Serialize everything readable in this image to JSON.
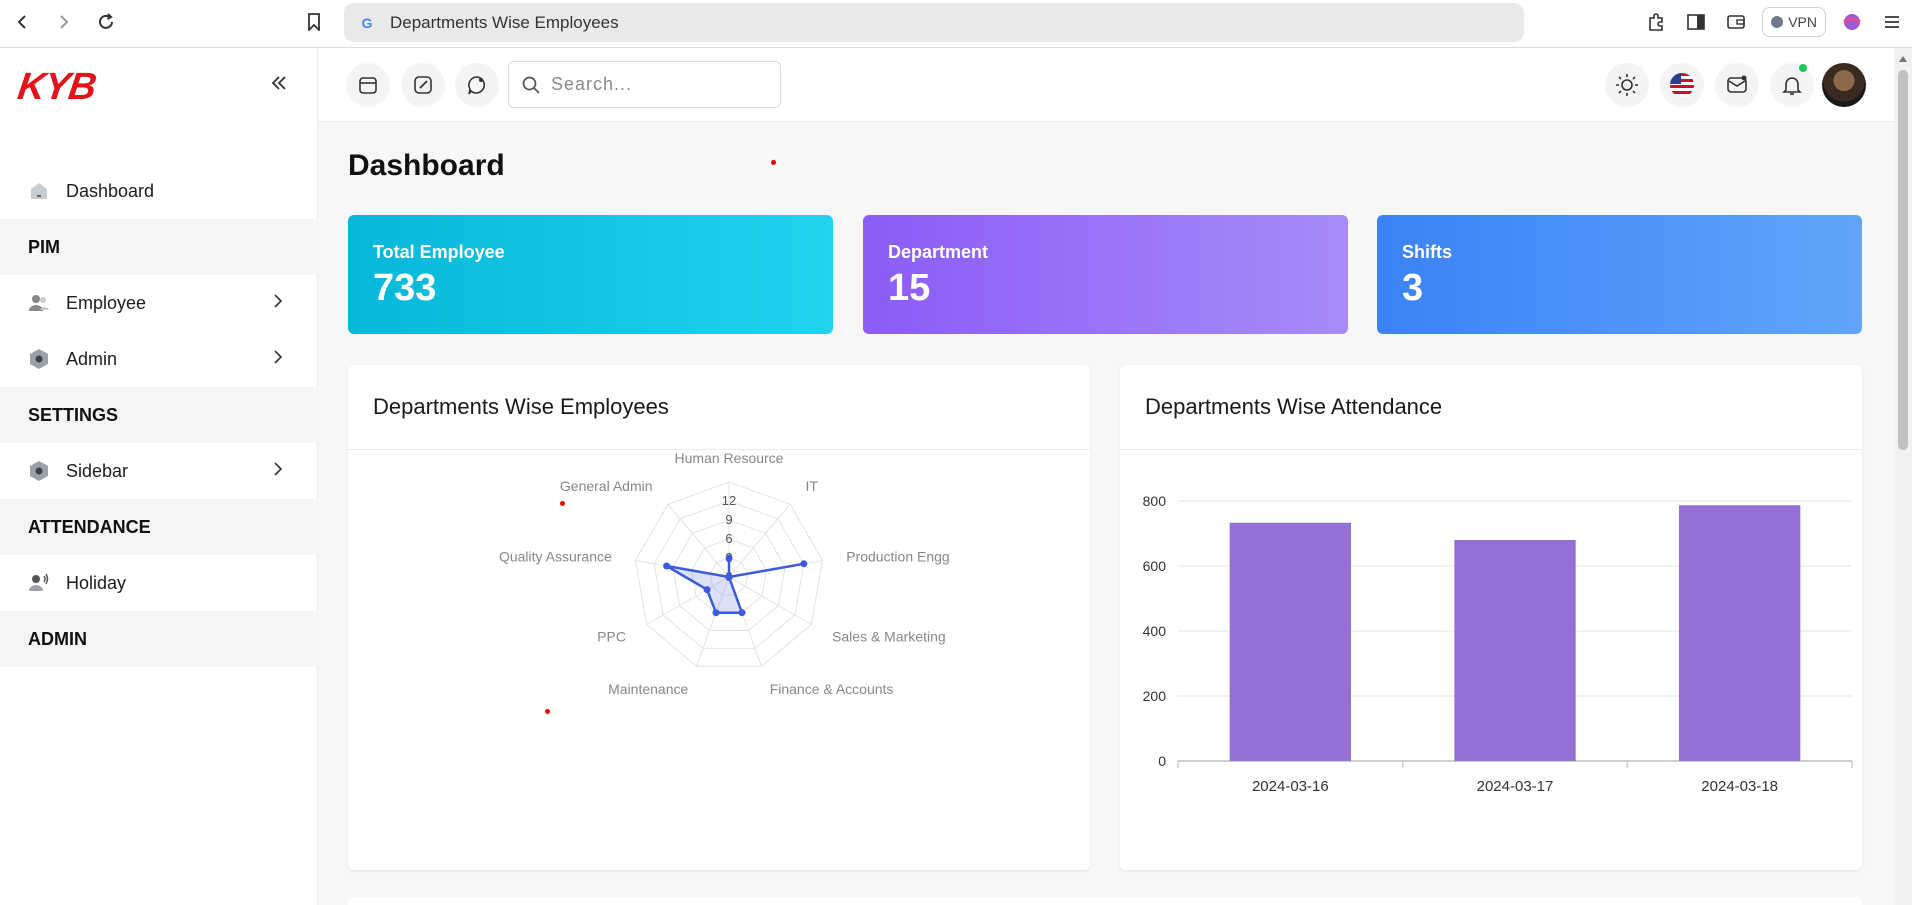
{
  "browser": {
    "url_text": "Departments Wise Employees",
    "vpn_label": "VPN"
  },
  "sidebar": {
    "brand": "KYB",
    "items": [
      {
        "type": "item",
        "label": "Dashboard",
        "icon": "dashboard-icon"
      },
      {
        "type": "section",
        "label": "PIM"
      },
      {
        "type": "item",
        "label": "Employee",
        "icon": "users-icon",
        "chevron": true
      },
      {
        "type": "item",
        "label": "Admin",
        "icon": "hexagon-icon",
        "chevron": true
      },
      {
        "type": "section",
        "label": "SETTINGS"
      },
      {
        "type": "item",
        "label": "Sidebar",
        "icon": "hexagon-icon",
        "chevron": true
      },
      {
        "type": "section",
        "label": "ATTENDANCE"
      },
      {
        "type": "item",
        "label": "Holiday",
        "icon": "user-voice-icon"
      },
      {
        "type": "section",
        "label": "ADMIN"
      }
    ]
  },
  "topbar": {
    "search_placeholder": "Search..."
  },
  "page": {
    "title": "Dashboard"
  },
  "stats": [
    {
      "label": "Total Employee",
      "value": "733"
    },
    {
      "label": "Department",
      "value": "15"
    },
    {
      "label": "Shifts",
      "value": "3"
    }
  ],
  "colors": {
    "brand": "#e3121b",
    "radar_line": "#3b5bdb",
    "bar_fill": "#9370d4"
  },
  "chart_data": [
    {
      "type": "radar",
      "title": "Departments Wise Employees",
      "categories": [
        "Human Resource",
        "IT",
        "Production Engg",
        "Sales & Marketing",
        "Finance & Accounts",
        "Maintenance",
        "PPC",
        "Quality Assurance",
        "General Admin"
      ],
      "values": [
        3,
        0,
        12,
        0,
        6,
        6,
        4,
        10,
        0
      ],
      "ticks": [
        "0",
        "3",
        "6",
        "9",
        "12"
      ],
      "rlim": [
        0,
        15
      ]
    },
    {
      "type": "bar",
      "title": "Departments Wise Attendance",
      "categories": [
        "2024-03-16",
        "2024-03-17",
        "2024-03-18"
      ],
      "values": [
        733,
        680,
        787
      ],
      "ylim": [
        0,
        800
      ],
      "yticks": [
        "0",
        "200",
        "400",
        "600",
        "800"
      ]
    }
  ]
}
